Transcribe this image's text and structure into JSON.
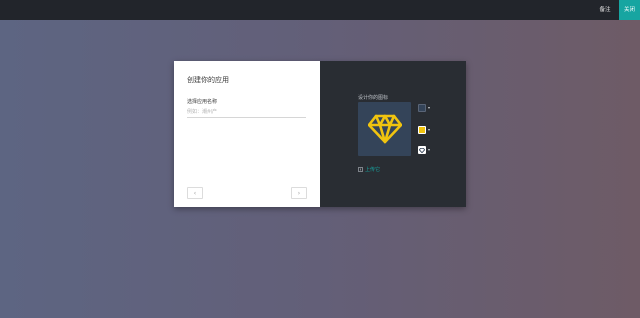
{
  "topbar": {
    "note_label": "备注",
    "close_label": "关闭"
  },
  "form": {
    "title": "创建你的应用",
    "name_label": "选择应用名称",
    "name_placeholder": "例如：潮州产",
    "prev_icon": "chevron-left-icon",
    "next_icon": "chevron-right-icon"
  },
  "icon_designer": {
    "label": "设计你的图标",
    "preview_icon": "diamond-icon",
    "background_color": "#344459",
    "icon_color": "#f1c40f",
    "upload_label": "上传它"
  },
  "colors": {
    "accent": "#17a5a1",
    "topbar": "#22252b",
    "panel_dark": "#292d33"
  }
}
